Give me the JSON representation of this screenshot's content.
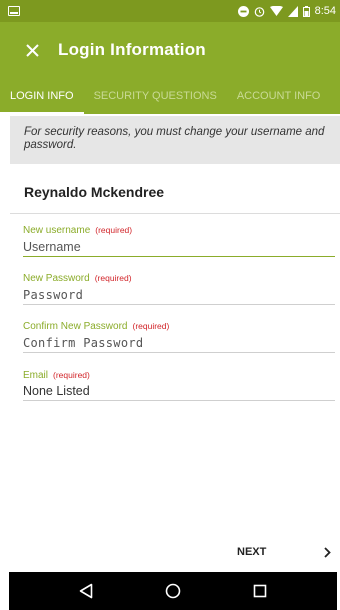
{
  "status_bar": {
    "time": "8:54"
  },
  "app_bar": {
    "title": "Login Information",
    "close_icon": "close-icon"
  },
  "tabs": [
    {
      "label": "LOGIN INFO",
      "active": true
    },
    {
      "label": "SECURITY QUESTIONS",
      "active": false
    },
    {
      "label": "ACCOUNT INFO",
      "active": false
    }
  ],
  "notice": "For security reasons, you must change your username and password.",
  "user": {
    "name": "Reynaldo Mckendree"
  },
  "form": {
    "required_text": "(required)",
    "username": {
      "label": "New username",
      "placeholder": "Username",
      "value": ""
    },
    "password": {
      "label": "New Password",
      "placeholder": "Password",
      "value": ""
    },
    "confirm": {
      "label": "Confirm New Password",
      "placeholder": "Confirm Password",
      "value": ""
    },
    "email": {
      "label": "Email",
      "value": "None Listed"
    }
  },
  "footer": {
    "next_label": "NEXT"
  },
  "colors": {
    "primary": "#8bac2a",
    "status": "#7d991f",
    "required": "#d2262b"
  }
}
